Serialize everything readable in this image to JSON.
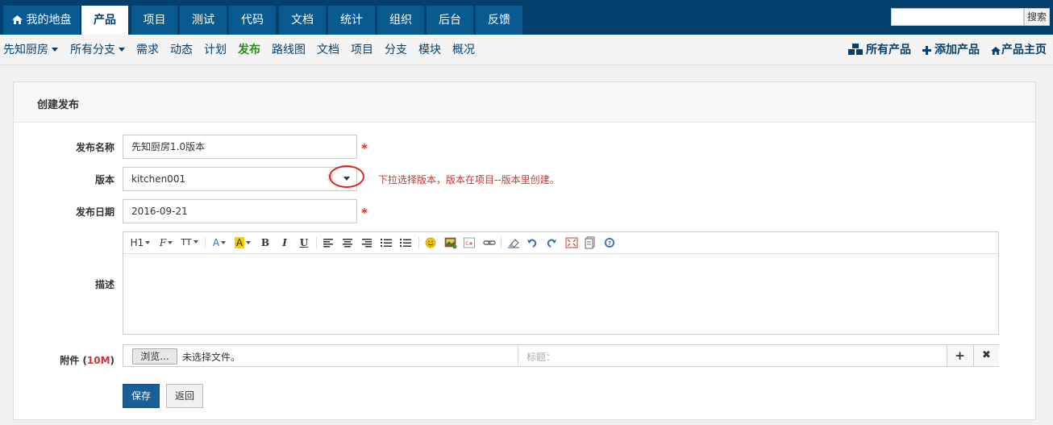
{
  "topnav": {
    "tabs": [
      {
        "label": "我的地盘",
        "icon": "home-icon"
      },
      {
        "label": "产品",
        "active": true
      },
      {
        "label": "项目"
      },
      {
        "label": "测试"
      },
      {
        "label": "代码"
      },
      {
        "label": "文档"
      },
      {
        "label": "统计"
      },
      {
        "label": "组织"
      },
      {
        "label": "后台"
      },
      {
        "label": "反馈"
      }
    ],
    "search_value": "",
    "search_button": "搜索"
  },
  "subnav": {
    "product_select": "先知厨房",
    "branch_select": "所有分支",
    "items": [
      "需求",
      "动态",
      "计划",
      "发布",
      "路线图",
      "文档",
      "项目",
      "分支",
      "模块",
      "概况"
    ],
    "active_item": "发布",
    "right": {
      "all_products": "所有产品",
      "add_product": "添加产品",
      "product_home": "产品主页"
    }
  },
  "form": {
    "title": "创建发布",
    "name_label": "发布名称",
    "name_value": "先知厨房1.0版本",
    "build_label": "版本",
    "build_value": "kitchen001",
    "build_clear": "✕",
    "annotation": "下拉选择版本，版本在项目--版本里创建。",
    "date_label": "发布日期",
    "date_value": "2016-09-21",
    "required_mark": "*",
    "desc_label": "描述",
    "toolbar": {
      "h1": "H1",
      "font": "F",
      "font_size": "TT",
      "font_color": "A",
      "bg_color": "A",
      "bold": "B",
      "italic": "I",
      "underline": "U"
    },
    "attach_label_prefix": "附件 (",
    "attach_size": "10M",
    "attach_label_suffix": ")",
    "browse_button": "浏览...",
    "no_file": "未选择文件。",
    "title_placeholder": "标题：",
    "add_symbol": "+",
    "remove_symbol": "✖",
    "save_button": "保存",
    "back_button": "返回"
  },
  "colors": {
    "topnav_bg": "#03406e",
    "accent_blue": "#1a5e98",
    "active_green": "#2d8a1c",
    "required_red": "#d2322d"
  }
}
